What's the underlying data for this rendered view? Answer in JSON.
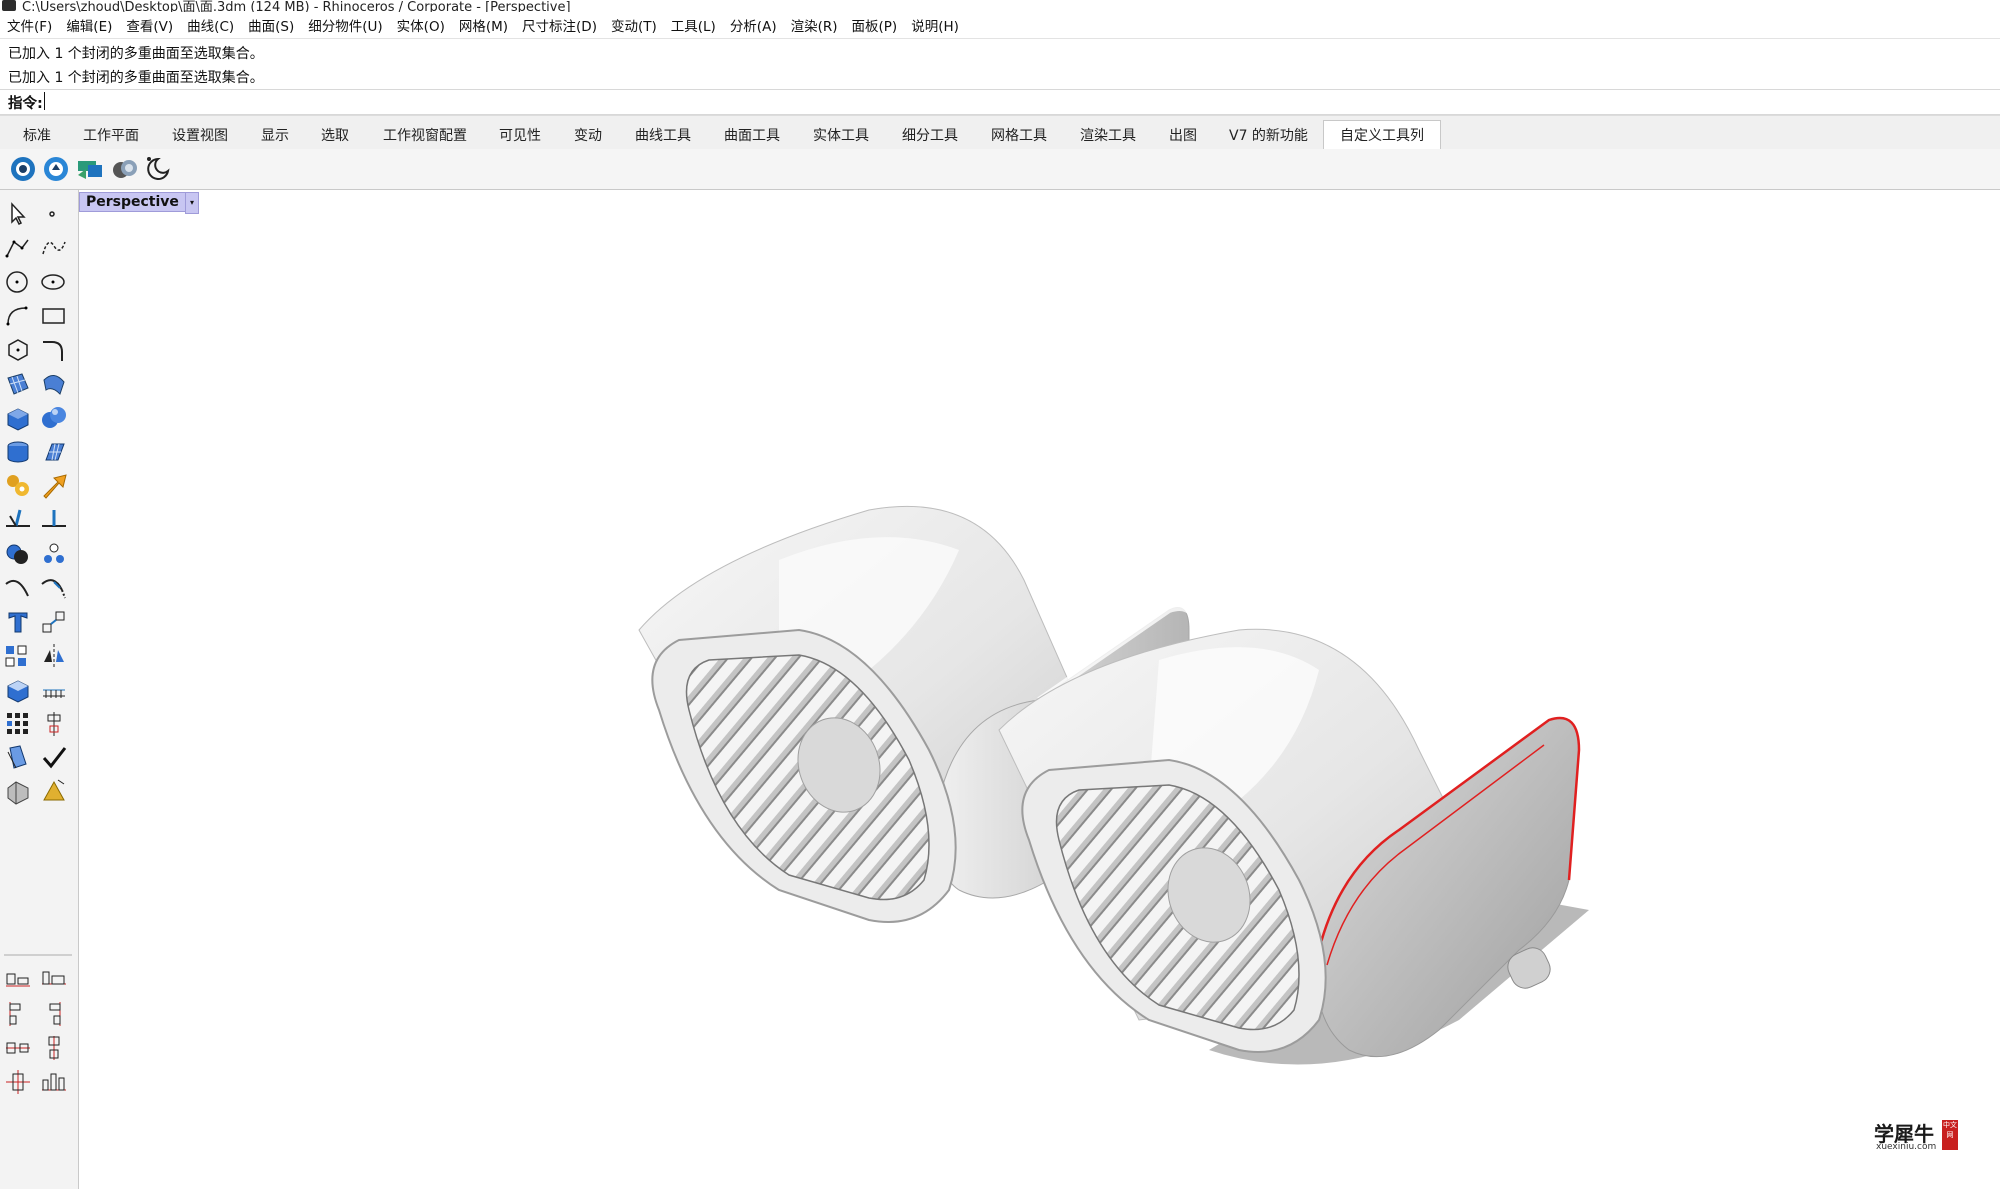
{
  "window": {
    "title": "C:\\Users\\zhoud\\Desktop\\面\\面.3dm (124 MB) - Rhinoceros / Corporate - [Perspective]"
  },
  "menu": {
    "items": [
      "文件(F)",
      "编辑(E)",
      "查看(V)",
      "曲线(C)",
      "曲面(S)",
      "细分物件(U)",
      "实体(O)",
      "网格(M)",
      "尺寸标注(D)",
      "变动(T)",
      "工具(L)",
      "分析(A)",
      "渲染(R)",
      "面板(P)",
      "说明(H)"
    ]
  },
  "command": {
    "history": [
      "已加入 1 个封闭的多重曲面至选取集合。",
      "已加入 1 个封闭的多重曲面至选取集合。"
    ],
    "prompt": "指令:",
    "value": ""
  },
  "tabs": {
    "items": [
      "标准",
      "工作平面",
      "设置视图",
      "显示",
      "选取",
      "工作视窗配置",
      "可见性",
      "变动",
      "曲线工具",
      "曲面工具",
      "实体工具",
      "细分工具",
      "网格工具",
      "渲染工具",
      "出图",
      "V7 的新功能",
      "自定义工具列"
    ],
    "active": "自定义工具列"
  },
  "toolbar": {
    "icons": [
      "render-sphere-icon",
      "render-settings-icon",
      "grasshopper-icon",
      "environment-icon",
      "sun-moon-icon"
    ]
  },
  "viewport": {
    "label": "Perspective",
    "dropdown_glyph": "▾"
  },
  "sidebar": {
    "icons": [
      "select-icon",
      "point-icon",
      "polyline-icon",
      "curve-icon",
      "circle-icon",
      "ellipse-icon",
      "arc-icon",
      "rectangle-icon",
      "polygon-icon",
      "fillet-curve-icon",
      "surface-icon",
      "sweep-icon",
      "box-icon",
      "solid-sphere-icon",
      "cylinder-icon",
      "mesh-plane-icon",
      "transform-gear-icon",
      "arrow-transform-icon",
      "trim-icon",
      "split-icon",
      "boolean-icon",
      "group-icon",
      "curve-offset-icon",
      "extend-icon",
      "text-icon",
      "scale-icon",
      "array-icon",
      "mirror-icon",
      "block-icon",
      "dimension-icon",
      "grid-array-icon",
      "align-icon",
      "paint-icon",
      "check-icon",
      "render-shape-icon",
      "shade-icon",
      "align-left-icon",
      "align-right-icon",
      "align-top-icon",
      "align-bottom-icon",
      "distribute-h-icon",
      "distribute-v-icon",
      "center-icon",
      "bars-icon"
    ]
  },
  "watermark": {
    "text": "学犀牛",
    "sub": "xuexiniu.com",
    "seal": "中文网"
  },
  "colors": {
    "accent": "#c8c6f2",
    "selection_edge": "#e02020",
    "toolbar_blue": "#1e73be"
  }
}
